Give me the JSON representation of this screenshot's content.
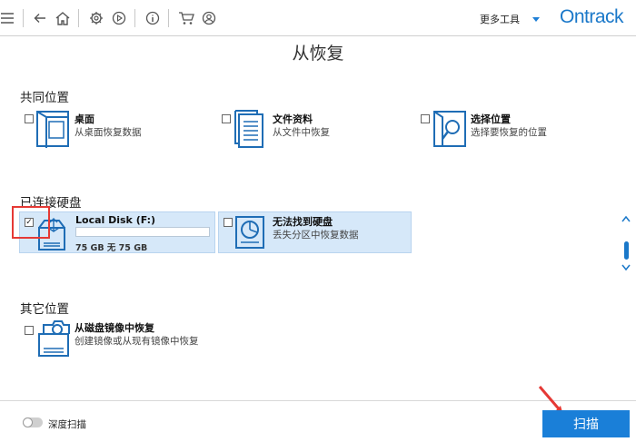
{
  "toolbar": {
    "icons": [
      "menu-icon",
      "back-icon",
      "home-icon",
      "settings-icon",
      "play-icon",
      "info-icon",
      "cart-icon",
      "account-icon"
    ],
    "more_tools_label": "更多工具",
    "brand": "Ontrack"
  },
  "page_title": "从恢复",
  "common": {
    "title": "共同位置",
    "items": [
      {
        "title": "桌面",
        "subtitle": "从桌面恢复数据",
        "icon": "desktop-icon"
      },
      {
        "title": "文件资料",
        "subtitle": "从文件中恢复",
        "icon": "documents-icon"
      },
      {
        "title": "选择位置",
        "subtitle": "选择要恢复的位置",
        "icon": "folder-search-icon"
      }
    ]
  },
  "connected": {
    "title": "已连接硬盘",
    "disks": [
      {
        "name": "Local Disk (F:)",
        "size": "75 GB 无 75 GB",
        "checked": true,
        "icon": "usb-drive-icon",
        "check_mark": "✓"
      },
      {
        "name": "无法找到硬盘",
        "subtitle": "丢失分区中恢复数据",
        "checked": false,
        "icon": "hard-drive-icon"
      }
    ]
  },
  "other": {
    "title": "其它位置",
    "items": [
      {
        "title": "从磁盘镜像中恢复",
        "subtitle": "创建镜像或从现有镜像中恢复",
        "icon": "disk-image-icon"
      }
    ]
  },
  "footer": {
    "deep_scan_label": "深度扫描",
    "scan_button": "扫描"
  },
  "colors": {
    "accent": "#1a7fd8",
    "selection": "#d6e8f9",
    "highlight": "#e53935"
  }
}
